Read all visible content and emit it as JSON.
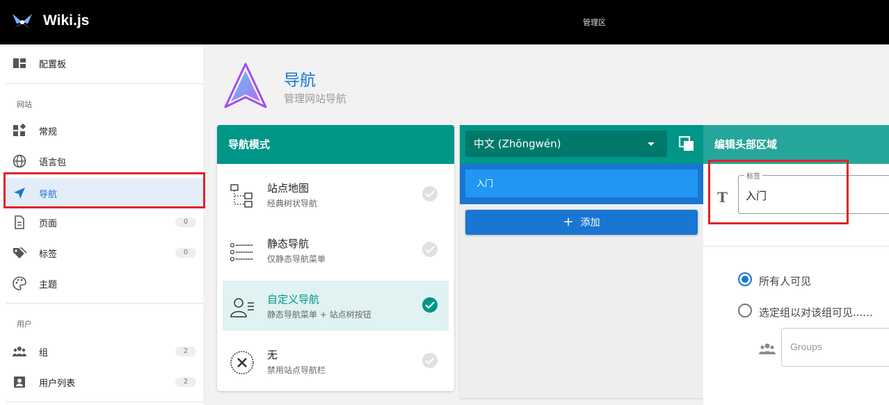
{
  "topbar": {
    "app_title": "Wiki.js",
    "admin_label": "管理区"
  },
  "sidebar": {
    "dashboard": "配置板",
    "section_site": "网站",
    "general": "常规",
    "locale": "语言包",
    "navigation": "导航",
    "pages": {
      "label": "页面",
      "count": "0"
    },
    "tags": {
      "label": "标签",
      "count": "0"
    },
    "theme": "主题",
    "section_users": "用户",
    "groups": {
      "label": "组",
      "count": "2"
    },
    "users": {
      "label": "用户列表",
      "count": "2"
    }
  },
  "page": {
    "title": "导航",
    "subtitle": "管理网站导航"
  },
  "mode_card": {
    "header": "导航模式",
    "items": [
      {
        "title": "站点地图",
        "subtitle": "经典树状导航"
      },
      {
        "title": "静态导航",
        "subtitle": "仅静态导航菜单"
      },
      {
        "title": "自定义导航",
        "subtitle": "静态导航菜单 + 站点树按钮"
      },
      {
        "title": "无",
        "subtitle": "禁用站点导航栏"
      }
    ]
  },
  "locale_panel": {
    "selected_locale": "中文 (Zhōngwén)",
    "entry": "入门",
    "add_label": "添加"
  },
  "edit_panel": {
    "header": "编辑头部区域",
    "field_legend": "标签",
    "field_value": "入门",
    "radio_everyone": "所有人可见",
    "radio_groups": "选定组以对该组可见......",
    "groups_placeholder": "Groups"
  },
  "colors": {
    "teal": "#009688",
    "blue": "#1976d2",
    "highlight": "#e32127"
  }
}
